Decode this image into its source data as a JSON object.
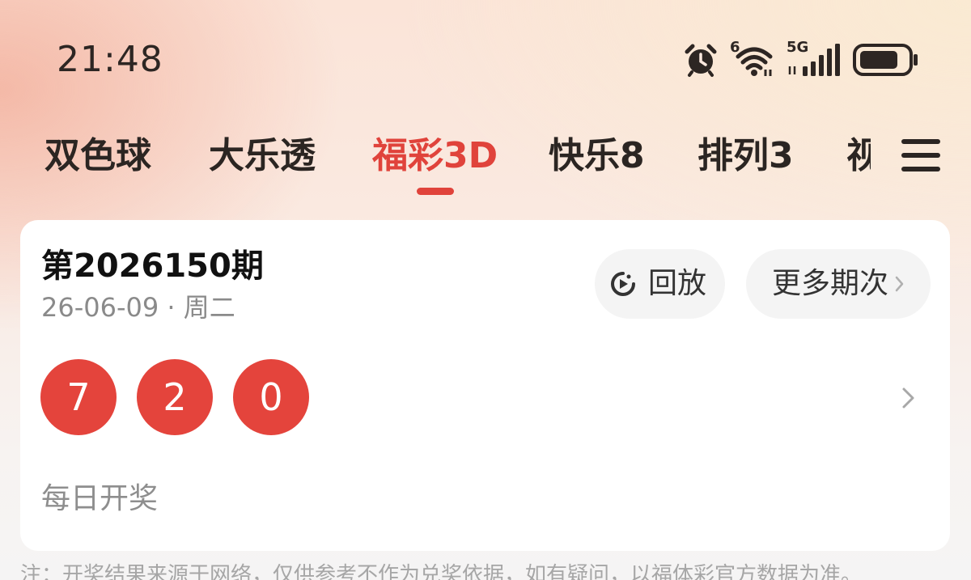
{
  "status_bar": {
    "time": "21:48",
    "wifi_badge": "6",
    "network_label": "5G",
    "icons": [
      "alarm-clock-icon",
      "wifi-icon",
      "cellular-signal-icon",
      "battery-icon"
    ]
  },
  "tabs": [
    {
      "label": "双色球",
      "active": false
    },
    {
      "label": "大乐透",
      "active": false
    },
    {
      "label": "福彩3D",
      "active": true
    },
    {
      "label": "快乐8",
      "active": false
    },
    {
      "label": "排列3",
      "active": false
    },
    {
      "label": "视",
      "active": false
    }
  ],
  "colors": {
    "accent": "#e0433b",
    "ball": "#e4443c",
    "text_primary": "#111111",
    "text_secondary": "#8a8a8a"
  },
  "result_card": {
    "issue": "第2026150期",
    "date": "26-06-09 · 周二",
    "replay_label": "回放",
    "more_label": "更多期次",
    "numbers": [
      "7",
      "2",
      "0"
    ],
    "draw_frequency": "每日开奖"
  },
  "footnote": "注：开奖结果来源于网络，仅供参考不作为兑奖依据，如有疑问，以福体彩官方数据为准。"
}
